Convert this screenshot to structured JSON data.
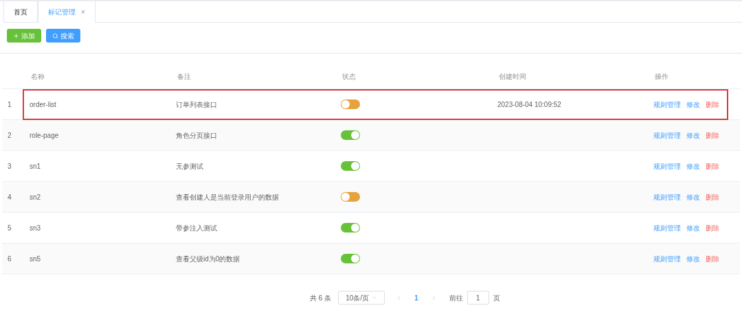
{
  "tabs": [
    {
      "label": "首页",
      "selected": false,
      "closable": false
    },
    {
      "label": "标记管理",
      "selected": true,
      "closable": true,
      "close_icon": "×"
    }
  ],
  "toolbar": {
    "buttons": [
      {
        "kind": "add",
        "label": "添加"
      },
      {
        "kind": "search",
        "label": "搜索"
      }
    ]
  },
  "table": {
    "columns": [
      "",
      "名称",
      "备注",
      "状态",
      "创建时间",
      "操作"
    ],
    "rows": [
      {
        "index": "1",
        "name": "order-list",
        "remark": "订单列表接口",
        "on": false,
        "created": "2023-08-04 10:09:52",
        "highlighted": true,
        "actions": [
          {
            "label": "规则管理",
            "kind": "link"
          },
          {
            "label": "修改",
            "kind": "link"
          },
          {
            "label": "删除",
            "kind": "danger"
          }
        ]
      },
      {
        "index": "2",
        "name": "role-page",
        "remark": "角色分页接口",
        "on": true,
        "highlighted": false,
        "actions": [
          {
            "label": "规则管理",
            "kind": "link"
          },
          {
            "label": "修改",
            "kind": "link"
          },
          {
            "label": "删除",
            "kind": "danger"
          }
        ]
      },
      {
        "index": "3",
        "name": "sn1",
        "remark": "无参测试",
        "on": true,
        "highlighted": false,
        "actions": [
          {
            "label": "规则管理",
            "kind": "link"
          },
          {
            "label": "修改",
            "kind": "link"
          },
          {
            "label": "删除",
            "kind": "danger"
          }
        ]
      },
      {
        "index": "4",
        "name": "sn2",
        "remark": "查看创建人是当前登录用户的数据",
        "on": false,
        "highlighted": false,
        "actions": [
          {
            "label": "规则管理",
            "kind": "link"
          },
          {
            "label": "修改",
            "kind": "link"
          },
          {
            "label": "删除",
            "kind": "danger"
          }
        ]
      },
      {
        "index": "5",
        "name": "sn3",
        "remark": "带参注入测试",
        "on": true,
        "highlighted": false,
        "actions": [
          {
            "label": "规则管理",
            "kind": "link"
          },
          {
            "label": "修改",
            "kind": "link"
          },
          {
            "label": "删除",
            "kind": "danger"
          }
        ]
      },
      {
        "index": "6",
        "name": "sn5",
        "remark": "查看父级id为0的数据",
        "on": true,
        "highlighted": false,
        "actions": [
          {
            "label": "规则管理",
            "kind": "link"
          },
          {
            "label": "修改",
            "kind": "link"
          },
          {
            "label": "删除",
            "kind": "danger"
          }
        ]
      }
    ]
  },
  "pagination": {
    "total": "共 6 条",
    "page_size": "10条/页",
    "pages": [
      {
        "label": "1",
        "selected": true
      }
    ],
    "goto_label": "前往",
    "goto_value": "1",
    "goto_suffix": "页"
  }
}
